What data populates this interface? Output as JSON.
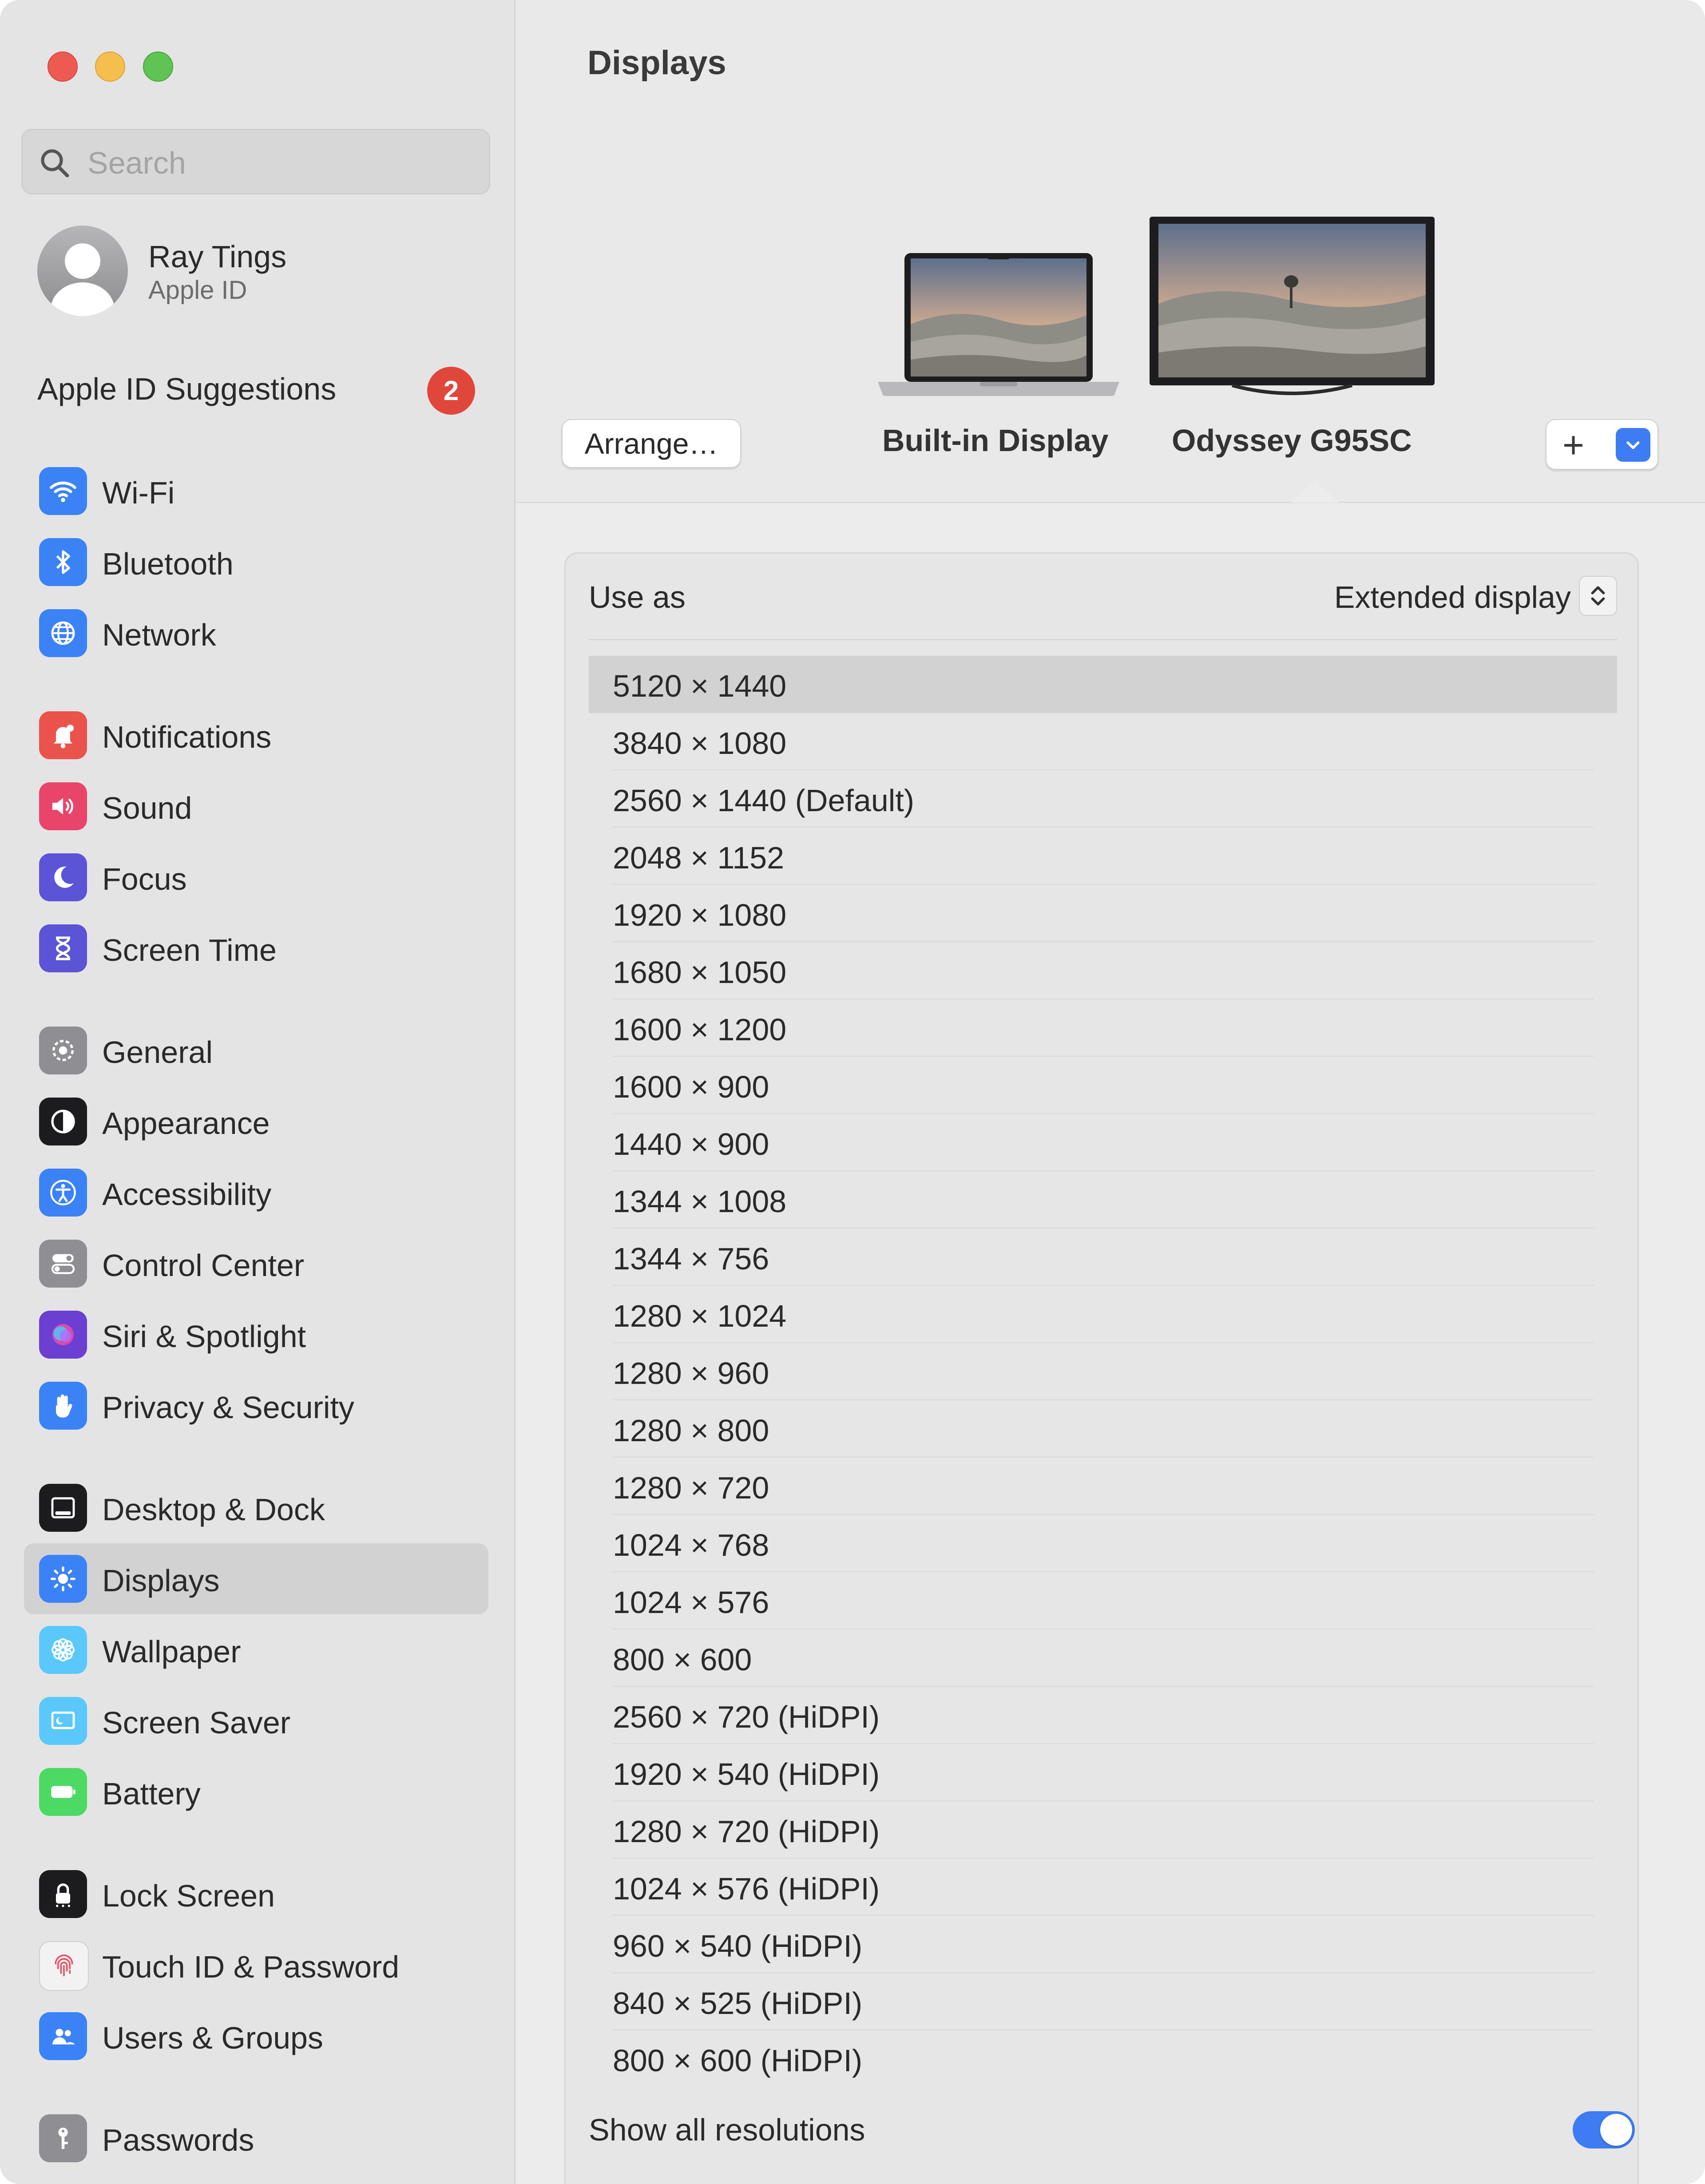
{
  "window": {
    "title": "Displays"
  },
  "search": {
    "placeholder": "Search"
  },
  "profile": {
    "name": "Ray Tings",
    "subtitle": "Apple ID"
  },
  "suggestions": {
    "label": "Apple ID Suggestions",
    "count": "2"
  },
  "sidebar": {
    "items": [
      {
        "label": "Wi-Fi",
        "icon": "wifi-icon",
        "color": "#3b82f6"
      },
      {
        "label": "Bluetooth",
        "icon": "bluetooth-icon",
        "color": "#3b82f6"
      },
      {
        "label": "Network",
        "icon": "globe-icon",
        "color": "#3b82f6"
      },
      {
        "label": "Notifications",
        "icon": "bell-icon",
        "color": "#e9534b"
      },
      {
        "label": "Sound",
        "icon": "speaker-icon",
        "color": "#e9456a"
      },
      {
        "label": "Focus",
        "icon": "moon-icon",
        "color": "#5b54d6"
      },
      {
        "label": "Screen Time",
        "icon": "hourglass-icon",
        "color": "#5b54d6"
      },
      {
        "label": "General",
        "icon": "gear-icon",
        "color": "#8e8e93"
      },
      {
        "label": "Appearance",
        "icon": "appearance-icon",
        "color": "#1c1c1e"
      },
      {
        "label": "Accessibility",
        "icon": "accessibility-icon",
        "color": "#3b82f6"
      },
      {
        "label": "Control Center",
        "icon": "toggles-icon",
        "color": "#8e8e93"
      },
      {
        "label": "Siri & Spotlight",
        "icon": "siri-icon",
        "color": "#6a3fd1"
      },
      {
        "label": "Privacy & Security",
        "icon": "hand-icon",
        "color": "#3b82f6"
      },
      {
        "label": "Desktop & Dock",
        "icon": "dock-icon",
        "color": "#1c1c1e"
      },
      {
        "label": "Displays",
        "icon": "sun-icon",
        "color": "#3b82f6",
        "selected": true
      },
      {
        "label": "Wallpaper",
        "icon": "flower-icon",
        "color": "#5ac8fa"
      },
      {
        "label": "Screen Saver",
        "icon": "screensaver-icon",
        "color": "#5ac8fa"
      },
      {
        "label": "Battery",
        "icon": "battery-icon",
        "color": "#4cd964"
      },
      {
        "label": "Lock Screen",
        "icon": "lock-icon",
        "color": "#1c1c1e"
      },
      {
        "label": "Touch ID & Password",
        "icon": "fingerprint-icon",
        "color": "#f2f2f2"
      },
      {
        "label": "Users & Groups",
        "icon": "users-icon",
        "color": "#3b82f6"
      },
      {
        "label": "Passwords",
        "icon": "key-icon",
        "color": "#8e8e93"
      }
    ]
  },
  "displays": {
    "arrange_label": "Arrange…",
    "builtin_label": "Built-in Display",
    "external_label": "Odyssey G95SC",
    "add_label": "+"
  },
  "settings": {
    "use_as_label": "Use as",
    "use_as_value": "Extended display",
    "resolutions": [
      "5120 × 1440",
      "3840 × 1080",
      "2560 × 1440 (Default)",
      "2048 × 1152",
      "1920 × 1080",
      "1680 × 1050",
      "1600 × 1200",
      "1600 × 900",
      "1440 × 900",
      "1344 × 1008",
      "1344 × 756",
      "1280 × 1024",
      "1280 × 960",
      "1280 × 800",
      "1280 × 720",
      "1024 × 768",
      "1024 × 576",
      "800 × 600",
      "2560 × 720 (HiDPI)",
      "1920 × 540 (HiDPI)",
      "1280 × 720 (HiDPI)",
      "1024 × 576 (HiDPI)",
      "960 × 540 (HiDPI)",
      "840 × 525 (HiDPI)",
      "800 × 600 (HiDPI)"
    ],
    "selected_resolution": "5120 × 1440",
    "show_all_label": "Show all resolutions",
    "show_all_enabled": true
  }
}
